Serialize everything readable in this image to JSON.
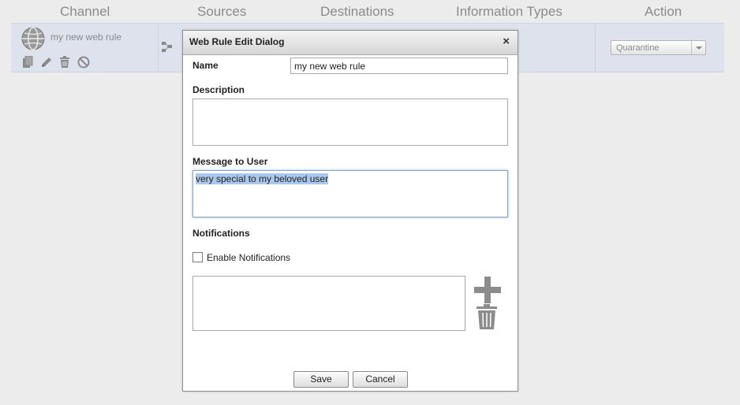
{
  "table": {
    "headers": {
      "channel": "Channel",
      "sources": "Sources",
      "destinations": "Destinations",
      "information_types": "Information Types",
      "action": "Action"
    },
    "row": {
      "rule_name": "my new web rule",
      "action_value": "Quarantine"
    }
  },
  "dialog": {
    "title": "Web Rule Edit Dialog",
    "close_glyph": "×",
    "name_label": "Name",
    "name_value": "my new web rule",
    "description_label": "Description",
    "description_value": "",
    "message_label": "Message to User",
    "message_value": "very special to my beloved user",
    "notifications_label": "Notifications",
    "enable_notifications_label": "Enable Notifications",
    "enable_notifications_checked": false,
    "save_label": "Save",
    "cancel_label": "Cancel"
  },
  "icons": {
    "channel": "globe-icon",
    "row_actions": [
      "copy-icon",
      "edit-pencil-icon",
      "trash-icon",
      "disable-icon"
    ],
    "sources": "sources-icon",
    "add": "plus-icon",
    "remove": "trash-icon"
  },
  "colors": {
    "selected_row": "#dde2ec",
    "selection_highlight": "#aac8ec",
    "focus_border": "#7fa9d2"
  }
}
